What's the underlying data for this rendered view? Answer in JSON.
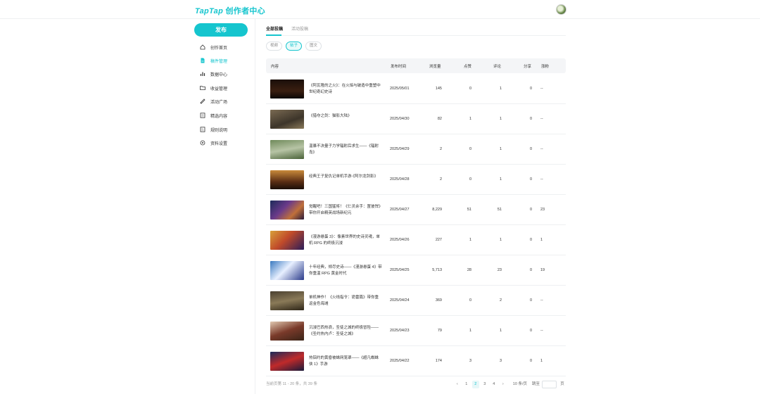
{
  "app": {
    "logo_brand": "TapTap",
    "logo_title": "创作者中心"
  },
  "sidebar": {
    "publish_label": "发布",
    "items": [
      {
        "label": "创作首页",
        "icon": "home-icon"
      },
      {
        "label": "稿件管理",
        "icon": "document-icon",
        "active": true
      },
      {
        "label": "数据中心",
        "icon": "bar-chart-icon"
      },
      {
        "label": "收益管理",
        "icon": "folder-icon"
      },
      {
        "label": "活动广场",
        "icon": "megaphone-icon"
      },
      {
        "label": "精选内容",
        "icon": "list-icon"
      },
      {
        "label": "规则说明",
        "icon": "rules-icon"
      },
      {
        "label": "资料设置",
        "icon": "settings-icon"
      }
    ]
  },
  "tabs": [
    {
      "label": "全部投稿"
    },
    {
      "label": "活动投稿"
    }
  ],
  "filters": [
    {
      "label": "视频"
    },
    {
      "label": "帖子"
    },
    {
      "label": "图文"
    }
  ],
  "table": {
    "headers": {
      "content": "内容",
      "date": "发布时间",
      "views": "浏览量",
      "likes": "点赞",
      "comments": "评论",
      "shares": "分享",
      "actions": "涨粉"
    },
    "rows": [
      {
        "title": "《阿瓦隆的之火》：在火焰与破造中重塑中世纪奇幻史诗",
        "date": "2025/05/01",
        "views": "145",
        "likes": "0",
        "comments": "1",
        "shares": "0",
        "extra": "--"
      },
      {
        "title": "《猎夺之剑：猫影大陆》",
        "date": "2025/04/30",
        "views": "82",
        "likes": "1",
        "comments": "1",
        "shares": "0",
        "extra": "--"
      },
      {
        "title": "温暴不决量子力学辐射后求生——《辐射岛》",
        "date": "2025/04/29",
        "views": "2",
        "likes": "0",
        "comments": "1",
        "shares": "0",
        "extra": "--"
      },
      {
        "title": "经典王子复仇记单机手游·《阿尔龙剑影》",
        "date": "2025/04/28",
        "views": "2",
        "likes": "0",
        "comments": "1",
        "shares": "0",
        "extra": "--"
      },
      {
        "title": "觉醒吧！三国猛将！《仁灵余手：置彼悍》带你开启精英战场新纪元",
        "date": "2025/04/27",
        "views": "8,229",
        "likes": "51",
        "comments": "51",
        "shares": "0",
        "extra": "23"
      },
      {
        "title": "《漫游悬蛋 3》：像素世界的史诗灵魂，单机 RPG 的终极沉浸",
        "date": "2025/04/26",
        "views": "227",
        "likes": "1",
        "comments": "1",
        "shares": "0",
        "extra": "1"
      },
      {
        "title": "十年经典，倾尽史诗——《漫游悬蛋 4》带你重温 RPG 黄金时代",
        "date": "2025/04/25",
        "views": "5,713",
        "likes": "28",
        "comments": "23",
        "shares": "0",
        "extra": "19"
      },
      {
        "title": "单机神作！《火线指令：诡雷篇》带你重返金色海滩",
        "date": "2025/04/24",
        "views": "369",
        "likes": "0",
        "comments": "2",
        "shares": "0",
        "extra": "--"
      },
      {
        "title": "沉浸巴西热浪，圣徒之城的终极冒险——《圣约热内卢：圣徒之城》",
        "date": "2025/04/23",
        "views": "79",
        "likes": "1",
        "comments": "1",
        "shares": "0",
        "extra": "--"
      },
      {
        "title": "热铝约的黄昏被蛛网笼罩——《超凡蜘蛛侠 1》手游",
        "date": "2025/04/22",
        "views": "174",
        "likes": "3",
        "comments": "3",
        "shares": "0",
        "extra": "1"
      }
    ]
  },
  "footer": {
    "summary": "当前页第 11 - 20 条，共 39 条",
    "pages": [
      "1",
      "2",
      "3",
      "4"
    ],
    "current_page": "2",
    "page_size": "10 条/页",
    "goto_label": "跳至",
    "page_suffix": "页"
  },
  "colors": {
    "accent": "#15c5ce"
  }
}
